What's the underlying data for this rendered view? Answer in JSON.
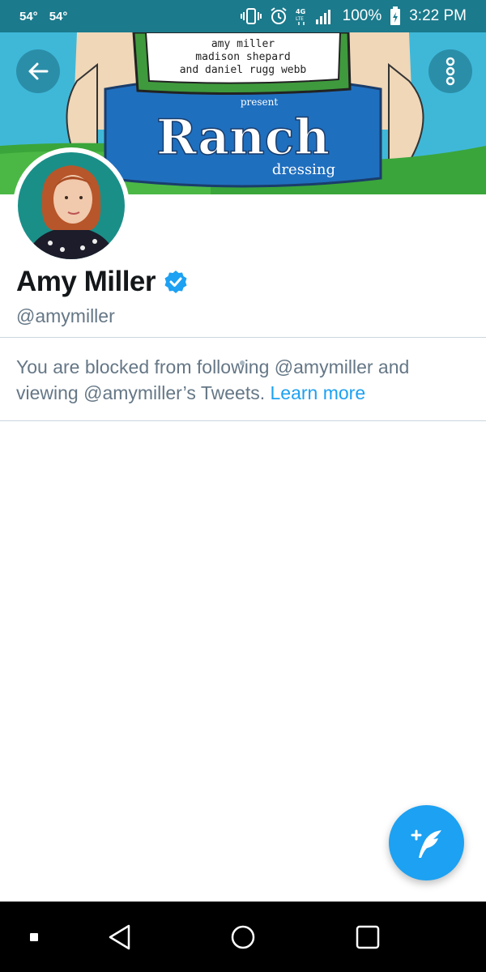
{
  "status_bar": {
    "temp_1": "54°",
    "temp_2": "54°",
    "network": "4G LTE",
    "battery": "100%",
    "time": "3:22 PM"
  },
  "banner": {
    "credit_line_1": "amy miller",
    "credit_line_2": "madison shepard",
    "credit_line_3": "and daniel rugg webb",
    "present": "present",
    "title": "Ranch",
    "subtitle": "dressing"
  },
  "profile": {
    "name": "Amy Miller",
    "handle": "@amymiller",
    "verified_color": "#1da1f2"
  },
  "blocked": {
    "message": "You are blocked from following @amymiller and viewing @amymiller’s Tweets.",
    "link": "Learn more"
  },
  "colors": {
    "accent": "#1da1f2",
    "status_bar": "#1b7a8c"
  }
}
